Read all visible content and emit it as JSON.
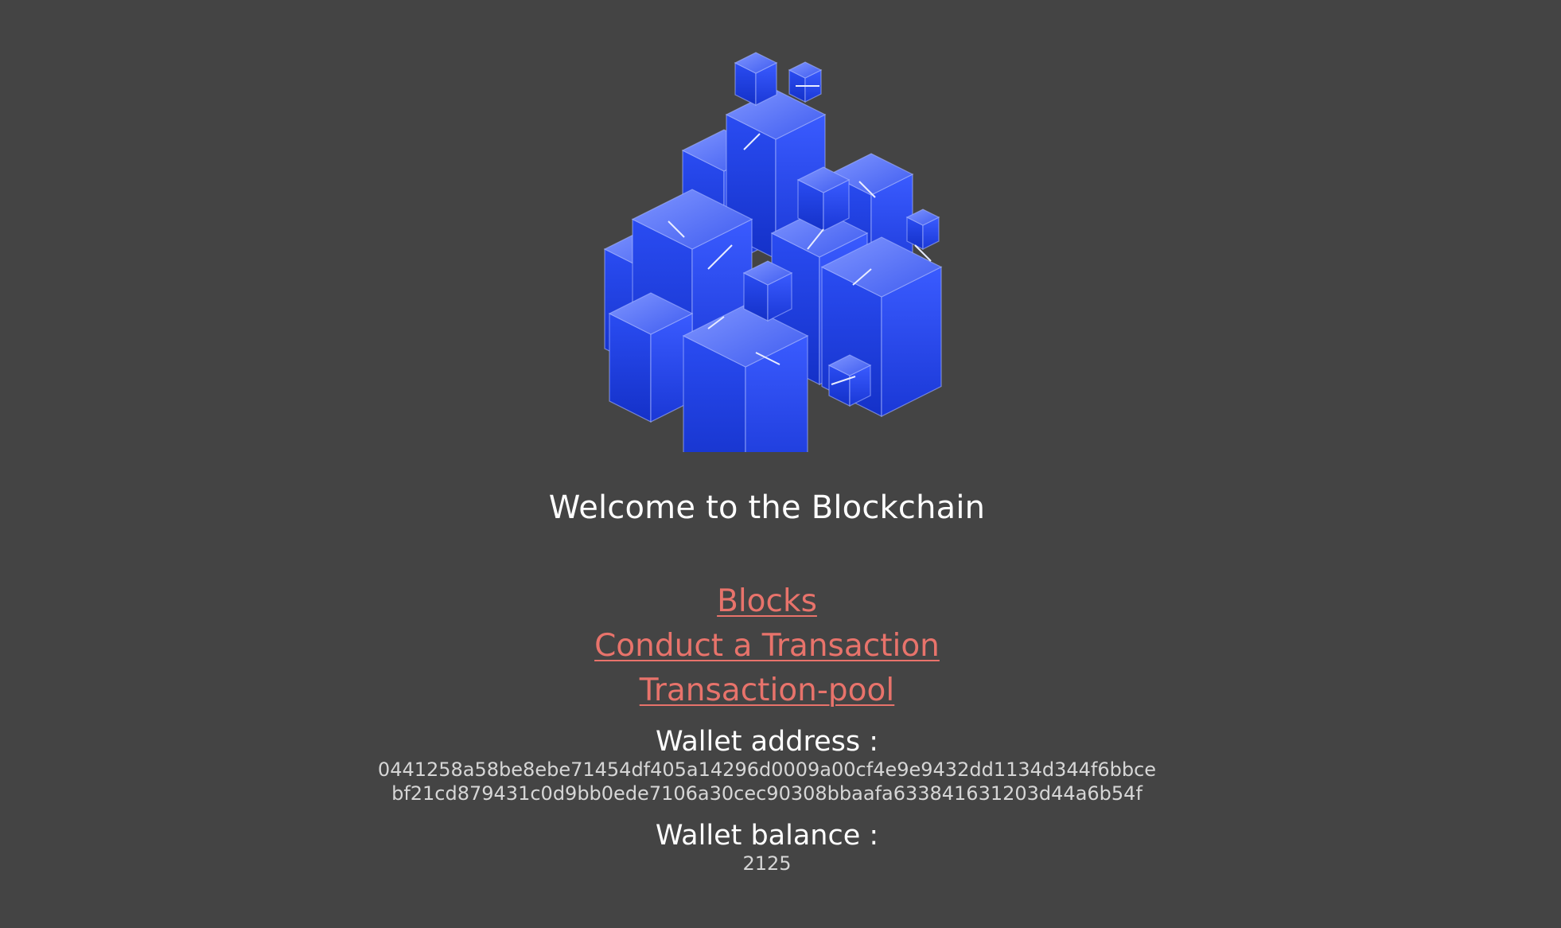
{
  "page": {
    "background": "#444444",
    "accent": "#e8736b"
  },
  "logo": {
    "icon": "blockchain-cubes-icon",
    "color": "#1a3fe0"
  },
  "welcome": {
    "text": "Welcome to the Blockchain"
  },
  "nav": {
    "items": [
      {
        "label": "Blocks"
      },
      {
        "label": "Conduct a Transaction"
      },
      {
        "label": "Transaction-pool"
      }
    ]
  },
  "wallet": {
    "address_label": "Wallet address :",
    "address_line1": "0441258a58be8ebe71454df405a14296d0009a00cf4e9e9432dd1134d344f6bbce",
    "address_line2": "bf21cd879431c0d9bb0ede7106a30cec90308bbaafa633841631203d44a6b54f",
    "balance_label": "Wallet balance :",
    "balance_value": "2125"
  }
}
